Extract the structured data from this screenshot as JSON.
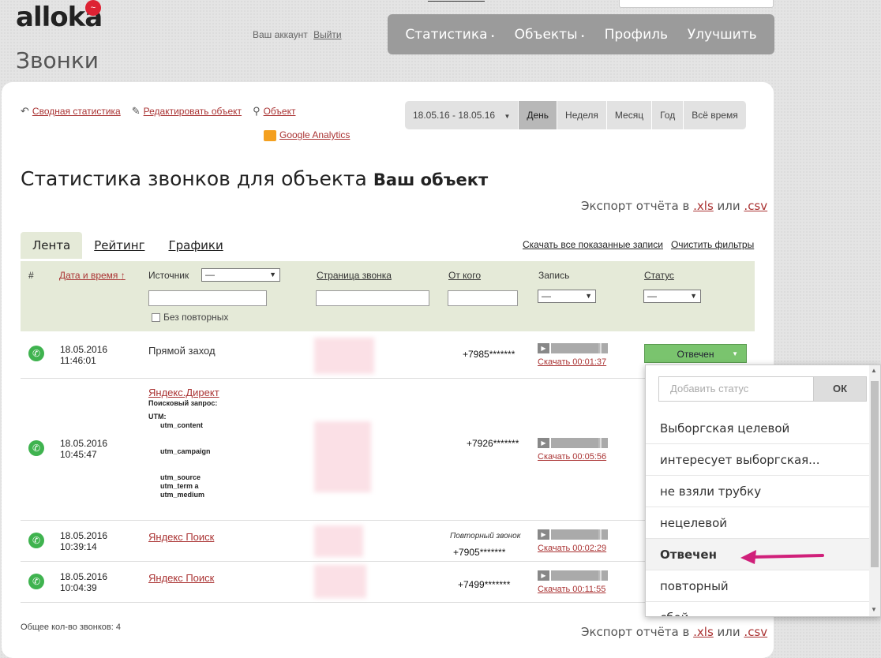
{
  "header": {
    "logo": "alloka",
    "page_heading": "Звонки",
    "account_label": "Ваш аккаунт",
    "logout": "Выйти",
    "nav": [
      {
        "label": "Статистика",
        "caret": "•"
      },
      {
        "label": "Объекты",
        "caret": "•"
      },
      {
        "label": "Профиль",
        "caret": ""
      },
      {
        "label": "Улучшить",
        "caret": ""
      }
    ]
  },
  "actions": {
    "summary": "Сводная статистика",
    "edit": "Редактировать объект",
    "object": "Объект",
    "ga": "Google Analytics"
  },
  "periods": {
    "range": "18.05.16  -  18.05.16",
    "day": "День",
    "week": "Неделя",
    "month": "Месяц",
    "year": "Год",
    "all": "Всё время"
  },
  "title": {
    "prefix": "Статистика звонков для объекта",
    "object_name": "Ваш объект"
  },
  "export": {
    "label": "Экспорт отчёта в",
    "xls": ".xls",
    "or": "или",
    "csv": ".csv"
  },
  "tabs": {
    "feed": "Лента",
    "rating": "Рейтинг",
    "graphs": "Графики"
  },
  "right_links": {
    "download": "Скачать все показанные записи",
    "clear": "Очистить фильтры"
  },
  "filter": {
    "num": "#",
    "date": "Дата и время",
    "date_arrow": "↑",
    "source": "Источник",
    "source_value": "—",
    "page": "Страница звонка",
    "from": "От кого",
    "record": "Запись",
    "record_value": "—",
    "status": "Статус",
    "status_value": "—",
    "no_repeat": "Без повторных"
  },
  "rows": [
    {
      "date": "18.05.2016",
      "time": "11:46:01",
      "source": "Прямой заход",
      "phone": "+7985*******",
      "download": "Скачать 00:01:37",
      "status": "Отвечен",
      "repeat": ""
    },
    {
      "date": "18.05.2016",
      "time": "10:45:47",
      "source": "Яндекс.Директ",
      "phone": "+7926*******",
      "download": "Скачать 00:05:56",
      "status": "",
      "repeat": ""
    },
    {
      "date": "18.05.2016",
      "time": "10:39:14",
      "source": "Яндекс Поиск",
      "phone": "+7905*******",
      "download": "Скачать 00:02:29",
      "status": "",
      "repeat": "Повторный звонок"
    },
    {
      "date": "18.05.2016",
      "time": "10:04:39",
      "source": "Яндекс Поиск",
      "phone": "+7499*******",
      "download": "Скачать 00:11:55",
      "status": "",
      "repeat": ""
    }
  ],
  "utm": {
    "query": "Поисковый запрос:",
    "utm": "UTM:",
    "content": "utm_content",
    "campaign": "utm_campaign",
    "source": "utm_source",
    "term": "utm_term a",
    "medium": "utm_medium"
  },
  "total": "Общее кол-во звонков: 4",
  "dropdown": {
    "placeholder": "Добавить статус",
    "ok": "ОК",
    "items": [
      "Выборгская целевой",
      "интересует выборгская...",
      "не взяли трубку",
      "нецелевой",
      "Отвечен",
      "повторный",
      "сбой"
    ]
  },
  "colors": {
    "nav_bg": "#9b9b9b",
    "filter_bg": "#e5ead8",
    "status_green": "#7ac46e",
    "link_red": "#aa3333",
    "annotation_arrow": "#d0207a"
  }
}
